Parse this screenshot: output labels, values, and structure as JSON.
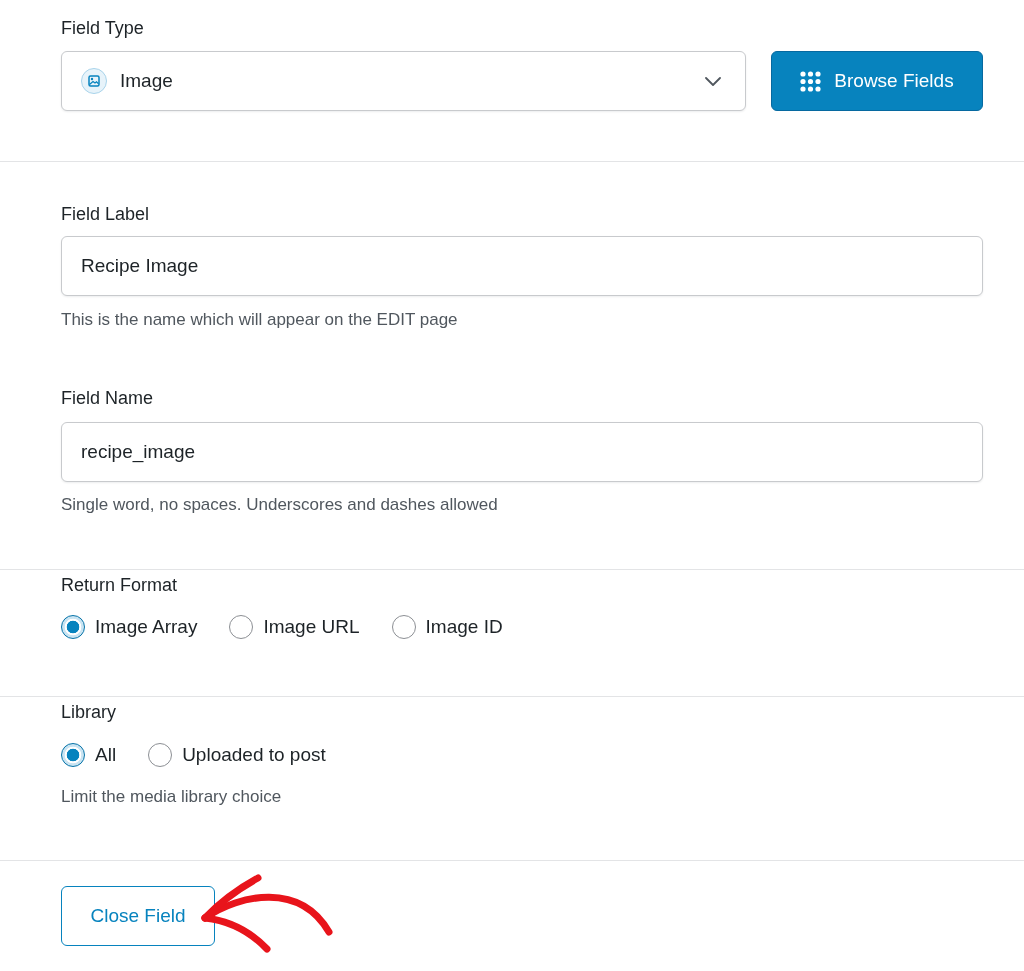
{
  "field_type": {
    "label": "Field Type",
    "value": "Image",
    "button": "Browse Fields"
  },
  "field_label": {
    "label": "Field Label",
    "value": "Recipe Image",
    "help": "This is the name which will appear on the EDIT page"
  },
  "field_name": {
    "label": "Field Name",
    "value": "recipe_image",
    "help": "Single word, no spaces. Underscores and dashes allowed"
  },
  "return_format": {
    "label": "Return Format",
    "options": [
      {
        "label": "Image Array",
        "selected": true
      },
      {
        "label": "Image URL",
        "selected": false
      },
      {
        "label": "Image ID",
        "selected": false
      }
    ]
  },
  "library": {
    "label": "Library",
    "options": [
      {
        "label": "All",
        "selected": true
      },
      {
        "label": "Uploaded to post",
        "selected": false
      }
    ],
    "help": "Limit the media library choice"
  },
  "close_button": "Close Field"
}
